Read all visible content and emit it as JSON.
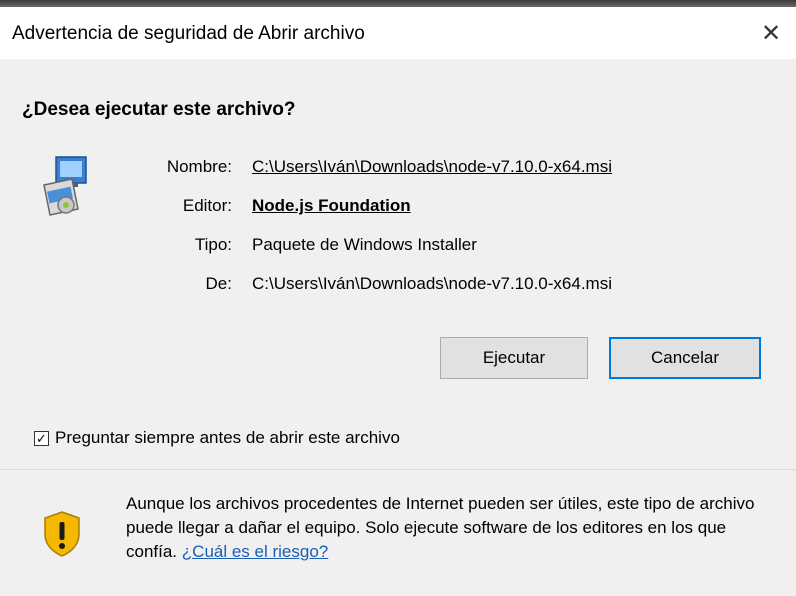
{
  "window": {
    "title": "Advertencia de seguridad de Abrir archivo",
    "close_glyph": "✕"
  },
  "question": "¿Desea ejecutar este archivo?",
  "icons": {
    "file": "installer-file-icon",
    "shield": "warning-shield-icon",
    "close": "close-icon",
    "checkbox": "checkmark-icon"
  },
  "details": {
    "name_label": "Nombre:",
    "name_value": "C:\\Users\\Iván\\Downloads\\node-v7.10.0-x64.msi",
    "publisher_label": "Editor:",
    "publisher_value": "Node.js Foundation",
    "type_label": "Tipo:",
    "type_value": "Paquete de Windows Installer",
    "from_label": "De:",
    "from_value": "C:\\Users\\Iván\\Downloads\\node-v7.10.0-x64.msi"
  },
  "buttons": {
    "run": "Ejecutar",
    "cancel": "Cancelar"
  },
  "checkbox": {
    "label": "Preguntar siempre antes de abrir este archivo",
    "checked_glyph": "✓"
  },
  "warning": {
    "text": "Aunque los archivos procedentes de Internet pueden ser útiles, este tipo de archivo puede llegar a dañar el equipo. Solo ejecute software de los editores en los que confía.",
    "link": "¿Cuál es el riesgo?"
  },
  "colors": {
    "link": "#1a5fb4",
    "dialog_bg": "#f0f0f0",
    "default_button_border": "#0078d7",
    "shield_fill": "#f5b800"
  }
}
